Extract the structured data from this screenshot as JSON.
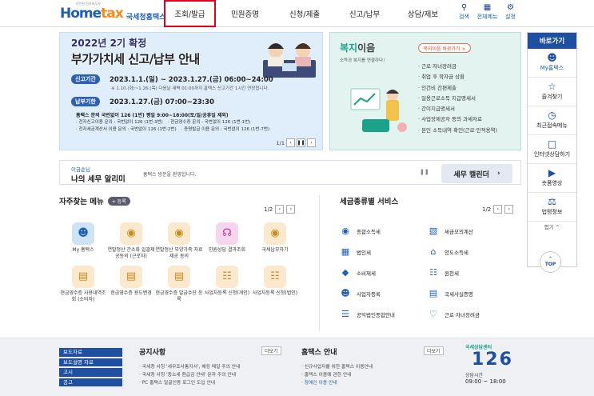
{
  "header": {
    "logo_small": "안전한 전자세무서",
    "logo_main": "Home",
    "logo_accent": "tax",
    "logo_name": "국세청홈택스",
    "nav": [
      "조회/발급",
      "민원증명",
      "신청/제출",
      "신고/납부",
      "상담/제보"
    ],
    "util": [
      {
        "label": "검색",
        "icon": "search-icon"
      },
      {
        "label": "전체메뉴",
        "icon": "menu-grid-icon"
      },
      {
        "label": "설정",
        "icon": "gear-icon"
      }
    ]
  },
  "banner": {
    "line1": "2022년 2기 확정",
    "line2": "부가가치세 신고/납부 안내",
    "period_label": "신고기간",
    "period_value": "2023.1.1.(일) ~ 2023.1.27.(금) 06:00~24:00",
    "period_note": "※ 1.10.(화)~1.26.(목) 다음날 새벽 01:00까지 홈택스 신고기간 1시간 연장됩니다.",
    "payment_label": "납부기한",
    "payment_value": "2023.1.27.(금) 07:00~23:30",
    "contact_main": "홈택스 문의 국번없이 126 (1번) 평일 9:00~18:00(토/일/공휴일 제외)",
    "contacts": [
      "· 전자신고이용 문의 : 국번없이 126 (1번-3번)",
      "· 현금영수증 문의 : 국번없이 126 (1번-1번)",
      "· 전자세금계산서 이용 문의 : 국번없이 126 (1번-2번)",
      "· 증명발급 이용 문의 : 국번없이 126 (1번-7번)"
    ],
    "page": "1/1"
  },
  "welfare": {
    "title_accent": "복지",
    "title_rest": "이음",
    "desc": "소득과 복지를 연결하다!",
    "button": "복지이음 바로가기 >",
    "items": [
      "근로·자녀장려금",
      "취업 후 학자금 상환",
      "인건비 간편제출",
      "일용근로소득 지급명세서",
      "간이지급명세서",
      "사업장제공자 등의 과세자료",
      "본인 소득내역 확인(근로·인적용역)"
    ]
  },
  "side": {
    "head": "바로가기",
    "items": [
      {
        "label": "My홈택스",
        "icon": "person-icon"
      },
      {
        "label": "즐겨찾기",
        "icon": "star-icon"
      },
      {
        "label": "최근접속메뉴",
        "icon": "clock-icon"
      },
      {
        "label": "인터넷상담하기",
        "icon": "chat-icon"
      },
      {
        "label": "숏폼영상",
        "icon": "play-icon"
      },
      {
        "label": "법령정보",
        "icon": "gavel-icon"
      }
    ],
    "fold": "접기 ^",
    "top": "TOP"
  },
  "notice": {
    "kicker": "이금순님",
    "title": "나의 세무 알리미",
    "message": "홈택스 방문을 환영합니다.",
    "button": "세무 캘린더"
  },
  "freq": {
    "title": "자주찾는 메뉴",
    "register": "+ 등록",
    "page": "1/2",
    "items": [
      {
        "label": "My 홈택스",
        "icon": "person-icon",
        "color": "#cfe3f7"
      },
      {
        "label": "연말정산 간소화 일괄제공동의 (근로자)",
        "icon": "moneybag-icon",
        "color": "#fbe9cf"
      },
      {
        "label": "연말정산 부양가족 자료제공 동의",
        "icon": "moneybag-icon",
        "color": "#fbe9cf"
      },
      {
        "label": "민원상담 결과조회",
        "icon": "headset-icon",
        "color": "#f6d6ef"
      },
      {
        "label": "국세납부하기",
        "icon": "moneybag-icon",
        "color": "#fbe9cf"
      },
      {
        "label": "현금영수증 사용내역조회 (소비자)",
        "icon": "receipt-icon",
        "color": "#fbe9cf"
      },
      {
        "label": "현금영수증 용도변경",
        "icon": "receipt-icon",
        "color": "#fbe9cf"
      },
      {
        "label": "현금영수증 발급수단 등록",
        "icon": "receipt-icon",
        "color": "#fbe9cf"
      },
      {
        "label": "사업자등록 신청(개인)",
        "icon": "document-icon",
        "color": "#fbe9cf"
      },
      {
        "label": "사업자등록 신청(법인)",
        "icon": "document-icon",
        "color": "#fbe9cf"
      }
    ]
  },
  "tax": {
    "title": "세금종류별 서비스",
    "page": "1/2",
    "left": [
      {
        "label": "종합소득세",
        "icon": "piggy-icon"
      },
      {
        "label": "법인세",
        "icon": "building-icon"
      },
      {
        "label": "소비제세",
        "icon": "diamond-icon"
      },
      {
        "label": "사업자등록",
        "icon": "person-icon"
      },
      {
        "label": "공익법인종합안내",
        "icon": "clipboard-icon"
      }
    ],
    "right": [
      {
        "label": "세금모의계산",
        "icon": "calculator-icon"
      },
      {
        "label": "양도소득세",
        "icon": "house-icon"
      },
      {
        "label": "원천세",
        "icon": "document-icon"
      },
      {
        "label": "국세사실증명",
        "icon": "certificate-icon"
      },
      {
        "label": "근로·자녀장려금",
        "icon": "heart-icon"
      }
    ]
  },
  "footer": {
    "tabs": [
      "보도자료",
      "보도설명 자료",
      "고시",
      "공고"
    ],
    "notice_title": "공지사항",
    "notice_more": "더보기",
    "notices": [
      "국세청 사칭 '세무조사통지서', 해킹 메일 주의 안내",
      "국세청 사칭 '종소세 환급금 안내' 문자 주의 안내",
      "PC 홈택스 얼굴인증 로그인 도입 안내"
    ],
    "guide_title": "홈택스 안내",
    "guide_more": "더보기",
    "guides": [
      "신규사업자를 위한 홈택스 이용안내",
      "홈택스 이용에 관한 안내",
      "장애인 이용 안내"
    ],
    "call_kicker": "국세상담센터",
    "call_number": "126",
    "call_hours_label": "상담시간",
    "call_hours": "09:00 ~ 18:00"
  }
}
